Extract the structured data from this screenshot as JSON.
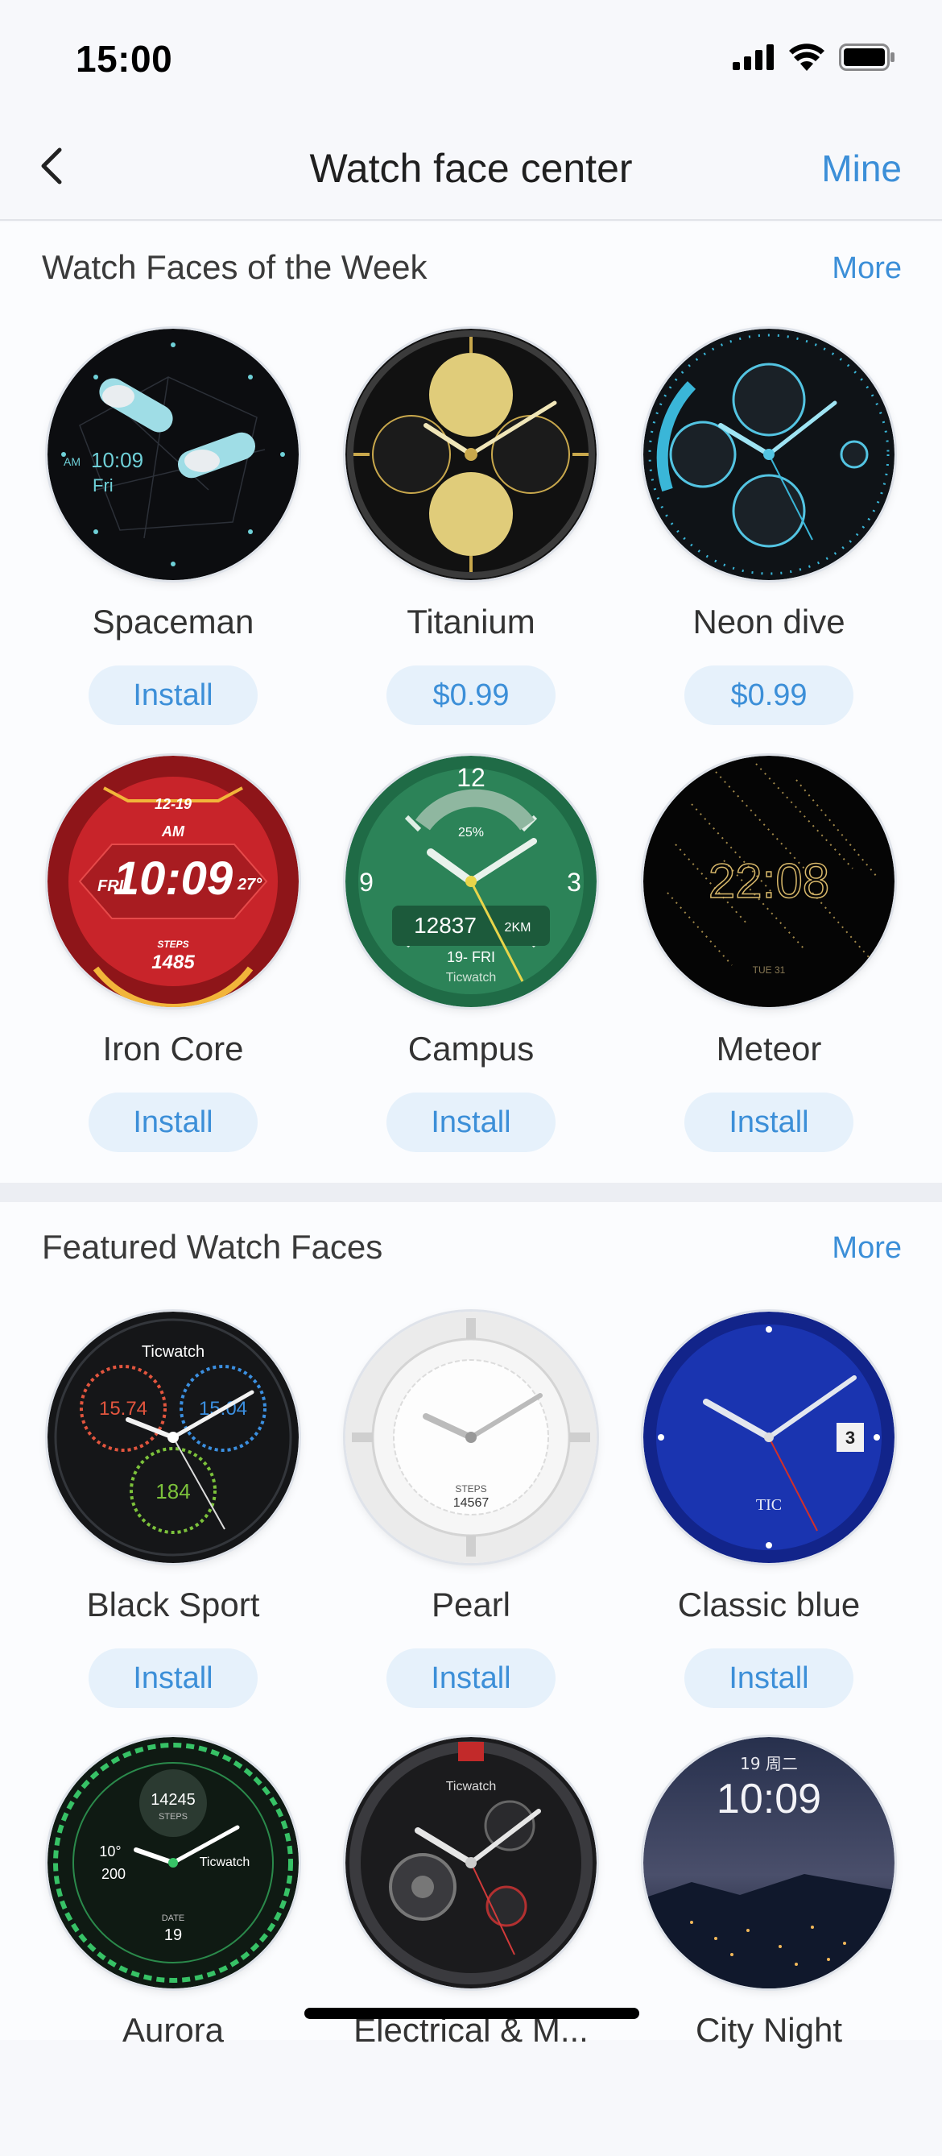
{
  "status": {
    "time": "15:00"
  },
  "nav": {
    "title": "Watch face center",
    "mine": "Mine"
  },
  "week": {
    "title": "Watch Faces of the Week",
    "more": "More",
    "items": [
      {
        "name": "Spaceman",
        "action": "Install"
      },
      {
        "name": "Titanium",
        "action": "$0.99"
      },
      {
        "name": "Neon dive",
        "action": "$0.99"
      },
      {
        "name": "Iron Core",
        "action": "Install"
      },
      {
        "name": "Campus",
        "action": "Install"
      },
      {
        "name": "Meteor",
        "action": "Install"
      }
    ]
  },
  "featured": {
    "title": "Featured Watch Faces",
    "more": "More",
    "items": [
      {
        "name": "Black Sport",
        "action": "Install"
      },
      {
        "name": "Pearl",
        "action": "Install"
      },
      {
        "name": "Classic blue",
        "action": "Install"
      },
      {
        "name": "Aurora",
        "action": ""
      },
      {
        "name": "Electrical & M...",
        "action": ""
      },
      {
        "name": "City Night",
        "action": ""
      }
    ]
  },
  "faces": {
    "spaceman": {
      "time": "10:09",
      "ampm": "AM",
      "day": "Fri"
    },
    "iron_core": {
      "date": "12-19",
      "ampm": "AM",
      "time": "10:09",
      "day": "FRI",
      "temp": "27°",
      "steps_label": "STEPS",
      "steps": "1485"
    },
    "campus": {
      "twelve": "12",
      "three": "3",
      "nine": "9",
      "pct": "25%",
      "steps": "12837",
      "km": "2KM",
      "date": "19- FRI",
      "brand": "Ticwatch"
    },
    "meteor": {
      "time": "22:08",
      "date": "TUE 31"
    },
    "black_sport": {
      "brand": "Ticwatch",
      "left": "15.74",
      "right": "15.04",
      "bottom": "184"
    },
    "pearl": {
      "steps_label": "STEPS",
      "steps": "14567"
    },
    "classic_blue": {
      "date": "3",
      "brand": "TIC"
    },
    "aurora": {
      "steps": "14245",
      "steps_label": "STEPS",
      "brand": "Ticwatch",
      "temp": "10°",
      "time": "200",
      "date_label": "DATE",
      "date": "19"
    },
    "electrical": {
      "brand": "Ticwatch"
    },
    "city_night": {
      "date": "19 周二",
      "time": "10:09"
    }
  },
  "colors": {
    "accent": "#3c8fd8",
    "button_bg": "#e6f1fb"
  }
}
